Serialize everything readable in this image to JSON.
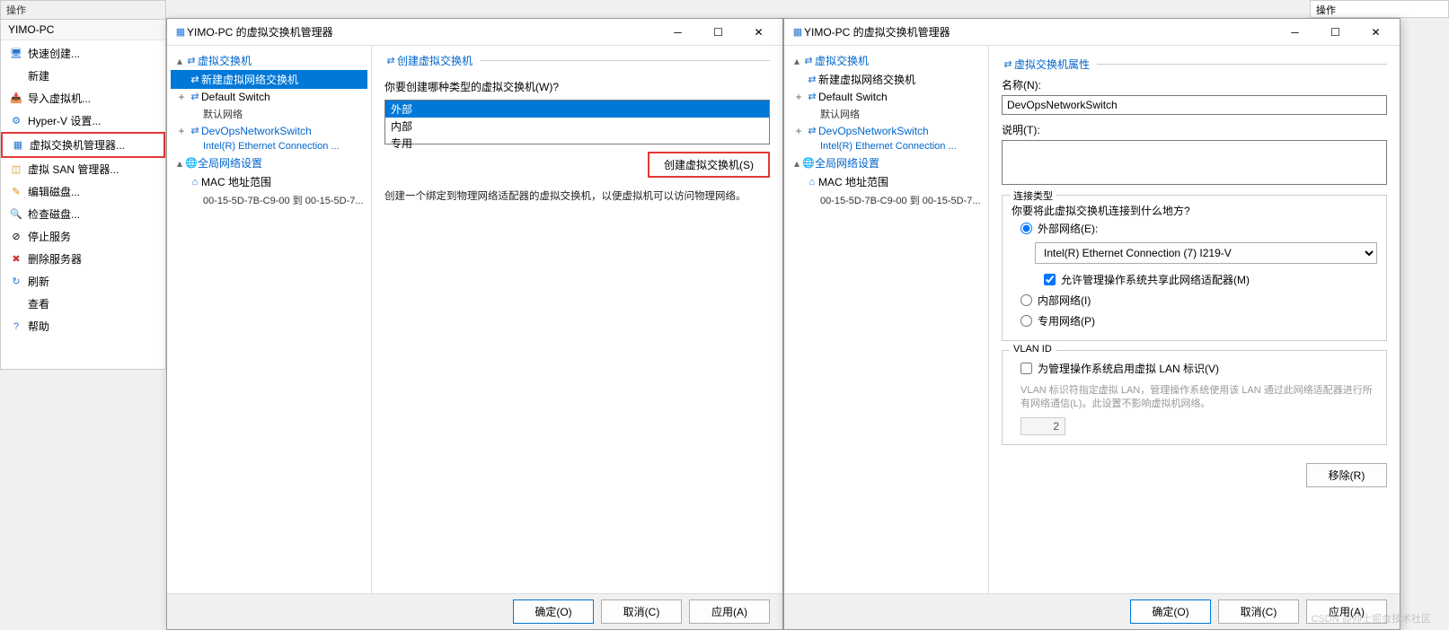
{
  "sidebar": {
    "header": "操作",
    "host": "YIMO-PC",
    "items": [
      {
        "label": "快速创建...",
        "icon": "🖥",
        "cls": "ico-blue"
      },
      {
        "label": "新建"
      },
      {
        "label": "导入虚拟机...",
        "icon": "📥",
        "cls": "ico-blue"
      },
      {
        "label": "Hyper-V 设置...",
        "icon": "⚙",
        "cls": "ico-blue"
      },
      {
        "label": "虚拟交换机管理器...",
        "icon": "▦",
        "cls": "ico-blue",
        "hl": true
      },
      {
        "label": "虚拟 SAN 管理器...",
        "icon": "◫",
        "cls": "ico-orange"
      },
      {
        "label": "编辑磁盘...",
        "icon": "✎",
        "cls": "ico-orange"
      },
      {
        "label": "检查磁盘...",
        "icon": "🔍",
        "cls": "ico-blue"
      },
      {
        "label": "停止服务",
        "icon": "⊘",
        "cls": ""
      },
      {
        "label": "删除服务器",
        "icon": "✖",
        "cls": "ico-red"
      },
      {
        "label": "刷新",
        "icon": "↻",
        "cls": "ico-blue"
      },
      {
        "label": "查看"
      },
      {
        "label": "帮助",
        "icon": "?",
        "cls": "ico-blue"
      }
    ]
  },
  "rightPanel": {
    "header": "操作"
  },
  "win1": {
    "title": "YIMO-PC 的虚拟交换机管理器",
    "tree": {
      "section1": "虚拟交换机",
      "item_new": "新建虚拟网络交换机",
      "item_default": "Default Switch",
      "item_default_sub": "默认网络",
      "item_devops": "DevOpsNetworkSwitch",
      "item_devops_sub": "Intel(R) Ethernet Connection ...",
      "section2": "全局网络设置",
      "item_mac": "MAC 地址范围",
      "item_mac_sub": "00-15-5D-7B-C9-00 到 00-15-5D-7..."
    },
    "panel": {
      "header": "创建虚拟交换机",
      "question": "你要创建哪种类型的虚拟交换机(W)?",
      "options": [
        "外部",
        "内部",
        "专用"
      ],
      "create_btn": "创建虚拟交换机(S)",
      "desc": "创建一个绑定到物理网络适配器的虚拟交换机，以便虚拟机可以访问物理网络。"
    },
    "buttons": {
      "ok": "确定(O)",
      "cancel": "取消(C)",
      "apply": "应用(A)"
    }
  },
  "win2": {
    "title": "YIMO-PC 的虚拟交换机管理器",
    "panel": {
      "header": "虚拟交换机属性",
      "name_label": "名称(N):",
      "name_value": "DevOpsNetworkSwitch",
      "desc_label": "说明(T):",
      "conn_group": "连接类型",
      "conn_q": "你要将此虚拟交换机连接到什么地方?",
      "radio_ext": "外部网络(E):",
      "adapter": "Intel(R) Ethernet Connection (7) I219-V",
      "share_check": "允许管理操作系统共享此网络适配器(M)",
      "radio_int": "内部网络(I)",
      "radio_priv": "专用网络(P)",
      "vlan_group": "VLAN ID",
      "vlan_check": "为管理操作系统启用虚拟 LAN 标识(V)",
      "vlan_help": "VLAN 标识符指定虚拟 LAN，管理操作系统使用该 LAN 通过此网络适配器进行所有网络通信(L)。此设置不影响虚拟机网络。",
      "vlan_value": "2",
      "remove_btn": "移除(R)"
    },
    "buttons": {
      "ok": "确定(O)",
      "cancel": "取消(C)",
      "apply": "应用(A)"
    }
  },
  "watermark": "CSDN @帅士掘金技术社区"
}
